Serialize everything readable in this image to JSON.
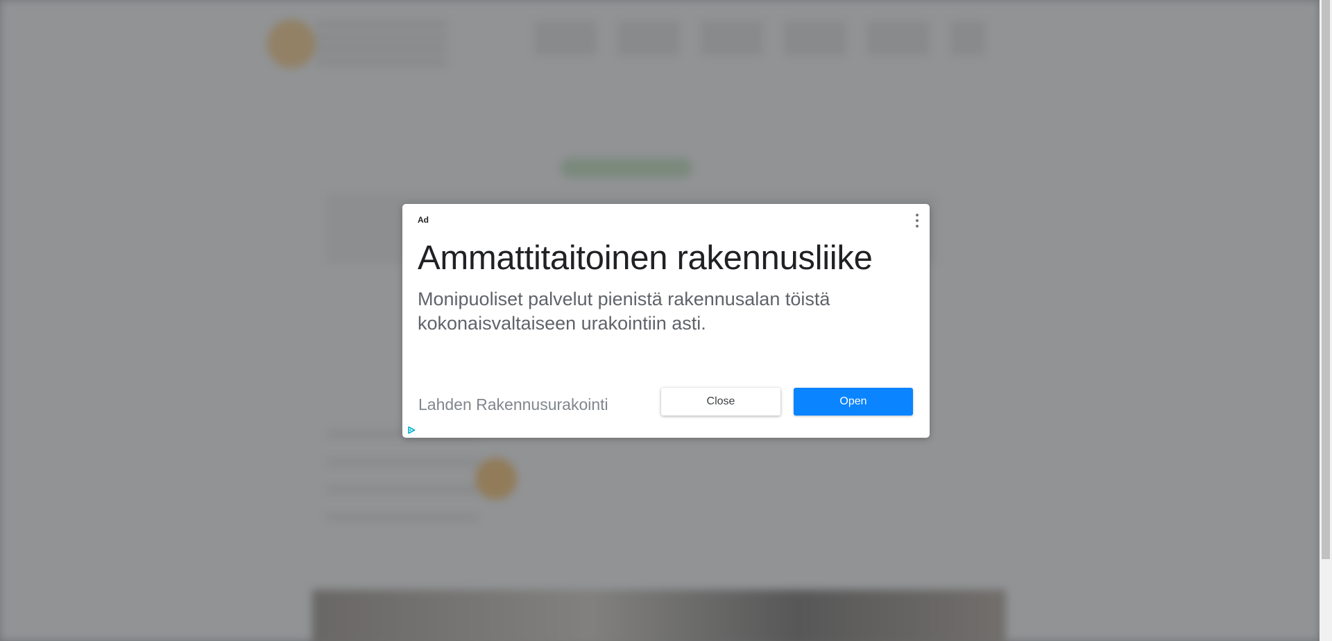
{
  "ad": {
    "label": "Ad",
    "menu_icon": "more-vert-icon",
    "headline": "Ammattitaitoinen rakennusliike",
    "description": "Monipuoliset palvelut pienistä rakennusalan töistä kokonaisvaltaiseen urakointiin asti.",
    "advertiser": "Lahden Rakennusurakointi",
    "close_label": "Close",
    "open_label": "Open",
    "adchoices_icon": "adchoices-icon",
    "open_button_color": "#0a84ff"
  }
}
